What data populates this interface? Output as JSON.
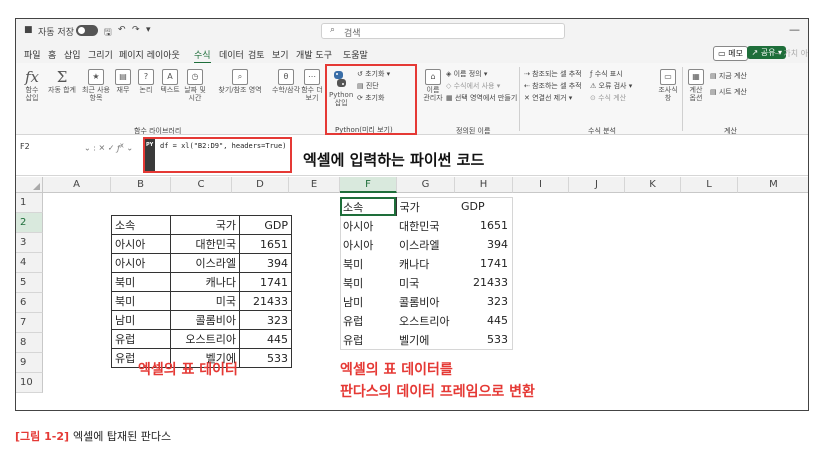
{
  "titlebar": {
    "autosave_label": "자동 저장",
    "toggle_state": "끔",
    "undo": "↶",
    "redo": "↷",
    "search_placeholder": "검색",
    "minimize": "—"
  },
  "menu": {
    "items": [
      "파일",
      "홈",
      "삽입",
      "그리기",
      "페이지 레이아웃",
      "수식",
      "데이터",
      "검토",
      "보기",
      "개발 도구",
      "도움말"
    ],
    "active": "수식",
    "memo": "메모",
    "share": "공유",
    "extra": "가치 아"
  },
  "ribbon": {
    "buttons": [
      {
        "label": "함수\n삽입",
        "glyph": "fx"
      },
      {
        "label": "자동 합계",
        "glyph": "Σ"
      },
      {
        "label": "최근 사용\n항목",
        "glyph": "★"
      },
      {
        "label": "재무",
        "glyph": "▤"
      },
      {
        "label": "논리",
        "glyph": "?"
      },
      {
        "label": "텍스트",
        "glyph": "A"
      },
      {
        "label": "날짜 및\n시간",
        "glyph": "◷"
      },
      {
        "label": "찾기/참조 영역",
        "glyph": "⌕"
      },
      {
        "label": "수학/삼각",
        "glyph": "θ"
      },
      {
        "label": "함수 더\n보기",
        "glyph": "⋯"
      }
    ],
    "group_function_library": "함수 라이브러리",
    "python": {
      "insert_label": "Python\n삽입",
      "init_label": "초기화",
      "diagnostics_label": "진단",
      "reset_label": "초기화",
      "group_label": "Python(미리 보기)"
    },
    "names": {
      "manager_label": "이름\n관리자",
      "define": "이름 정의",
      "use_in_formula": "수식에서 사용",
      "create_from_selection": "선택 영역에서 만들기",
      "group_label": "정의된 이름"
    },
    "auditing": {
      "trace_precedents": "참조되는 셀 추적",
      "trace_dependents": "참조하는 셀 추적",
      "remove_arrows": "연결선 제거",
      "show_formulas": "수식 표시",
      "error_checking": "오류 검사",
      "evaluate_formula": "수식 계산",
      "watch_window": "조사식\n창",
      "group_label": "수식 분석"
    },
    "calculation": {
      "options": "계산\n옵션",
      "calc_now": "지금 계산",
      "calc_sheet": "시트 계산",
      "group_label": "계산"
    }
  },
  "formula_bar": {
    "name_box": "F2",
    "py_tag": "PY",
    "formula": "df = xl(\"B2:D9\", headers=True)"
  },
  "annotations": {
    "python_code": "엑셀에 입력하는 파이썬 코드",
    "excel_data": "엑셀의 표 데이터",
    "pandas_line1": "엑셀의 표 데이터를",
    "pandas_line2": "판다스의 데이터 프레임으로 변환"
  },
  "grid": {
    "columns": [
      "A",
      "B",
      "C",
      "D",
      "E",
      "F",
      "G",
      "H",
      "I",
      "J",
      "K",
      "L",
      "M"
    ],
    "selected_column": "F",
    "rows": [
      "1",
      "2",
      "3",
      "4",
      "5",
      "6",
      "7",
      "8",
      "9",
      "10"
    ],
    "selected_row": "2"
  },
  "excel_table": {
    "headers": [
      "소속",
      "국가",
      "GDP"
    ],
    "rows": [
      [
        "아시아",
        "대한민국",
        "1651"
      ],
      [
        "아시아",
        "이스라엘",
        "394"
      ],
      [
        "북미",
        "캐나다",
        "1741"
      ],
      [
        "북미",
        "미국",
        "21433"
      ],
      [
        "남미",
        "콜롬비아",
        "323"
      ],
      [
        "유럽",
        "오스트리아",
        "445"
      ],
      [
        "유럽",
        "벨기에",
        "533"
      ]
    ]
  },
  "dataframe_table": {
    "headers": [
      "소속",
      "국가",
      "GDP"
    ],
    "rows": [
      [
        "아시아",
        "대한민국",
        "1651"
      ],
      [
        "아시아",
        "이스라엘",
        "394"
      ],
      [
        "북미",
        "캐나다",
        "1741"
      ],
      [
        "북미",
        "미국",
        "21433"
      ],
      [
        "남미",
        "콜롬비아",
        "323"
      ],
      [
        "유럽",
        "오스트리아",
        "445"
      ],
      [
        "유럽",
        "벨기에",
        "533"
      ]
    ]
  },
  "caption": {
    "number": "[그림 1-2]",
    "text": "엑셀에 탑재된 판다스"
  },
  "colors": {
    "accent_green": "#1e6e3a",
    "highlight_red": "#e53935"
  }
}
